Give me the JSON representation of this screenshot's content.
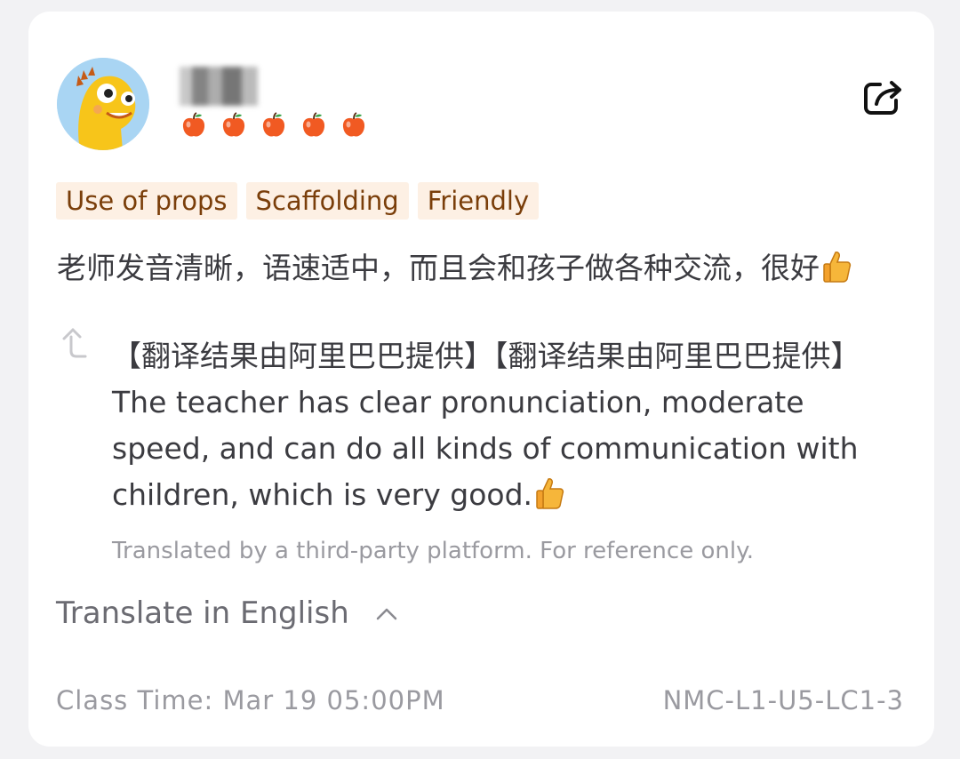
{
  "user": {
    "name": ""
  },
  "rating": {
    "value": 5,
    "max": 5,
    "icon": "apple-icon",
    "color": "#f15a22"
  },
  "tags": [
    "Use of props",
    "Scaffolding",
    "Friendly"
  ],
  "review": {
    "text": "老师发音清晰，语速适中，而且会和孩子做各种交流，很好"
  },
  "translation": {
    "text": "【翻译结果由阿里巴巴提供】【翻译结果由阿里巴巴提供】The teacher has clear pronunciation, moderate speed, and can do all kinds of communication with children, which is very good.",
    "disclaimer": "Translated by a third-party platform. For reference only."
  },
  "translate_toggle": {
    "label": "Translate in English"
  },
  "footer": {
    "class_time": "Class Time: Mar 19 05:00PM",
    "class_code": "NMC-L1-U5-LC1-3"
  },
  "colors": {
    "tag_bg": "#fdf0e4",
    "tag_text": "#7a3e0a",
    "muted": "#9a9aa0",
    "text": "#3b3b40"
  }
}
